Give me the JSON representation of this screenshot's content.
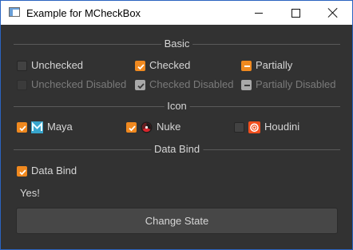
{
  "window": {
    "title": "Example for MCheckBox"
  },
  "sections": {
    "basic": "Basic",
    "icon": "Icon",
    "data_bind": "Data Bind"
  },
  "basic": {
    "unchecked": {
      "label": "Unchecked",
      "state": "unchecked",
      "enabled": true
    },
    "checked": {
      "label": "Checked",
      "state": "checked",
      "enabled": true
    },
    "partially": {
      "label": "Partially",
      "state": "partial",
      "enabled": true
    },
    "unchecked_disabled": {
      "label": "Unchecked Disabled",
      "state": "unchecked",
      "enabled": false
    },
    "checked_disabled": {
      "label": "Checked Disabled",
      "state": "checked",
      "enabled": false
    },
    "partially_disabled": {
      "label": "Partially Disabled",
      "state": "partial",
      "enabled": false
    }
  },
  "icon": {
    "maya": {
      "label": "Maya",
      "state": "checked",
      "icon": "maya-icon"
    },
    "nuke": {
      "label": "Nuke",
      "state": "checked",
      "icon": "nuke-icon"
    },
    "houdini": {
      "label": "Houdini",
      "state": "unchecked",
      "icon": "houdini-icon"
    }
  },
  "data_bind": {
    "checkbox": {
      "label": "Data Bind",
      "state": "checked"
    },
    "status_text": "Yes!",
    "button_label": "Change State"
  },
  "colors": {
    "accent": "#f0891f",
    "background": "#323232",
    "text": "#d6d6d6"
  }
}
